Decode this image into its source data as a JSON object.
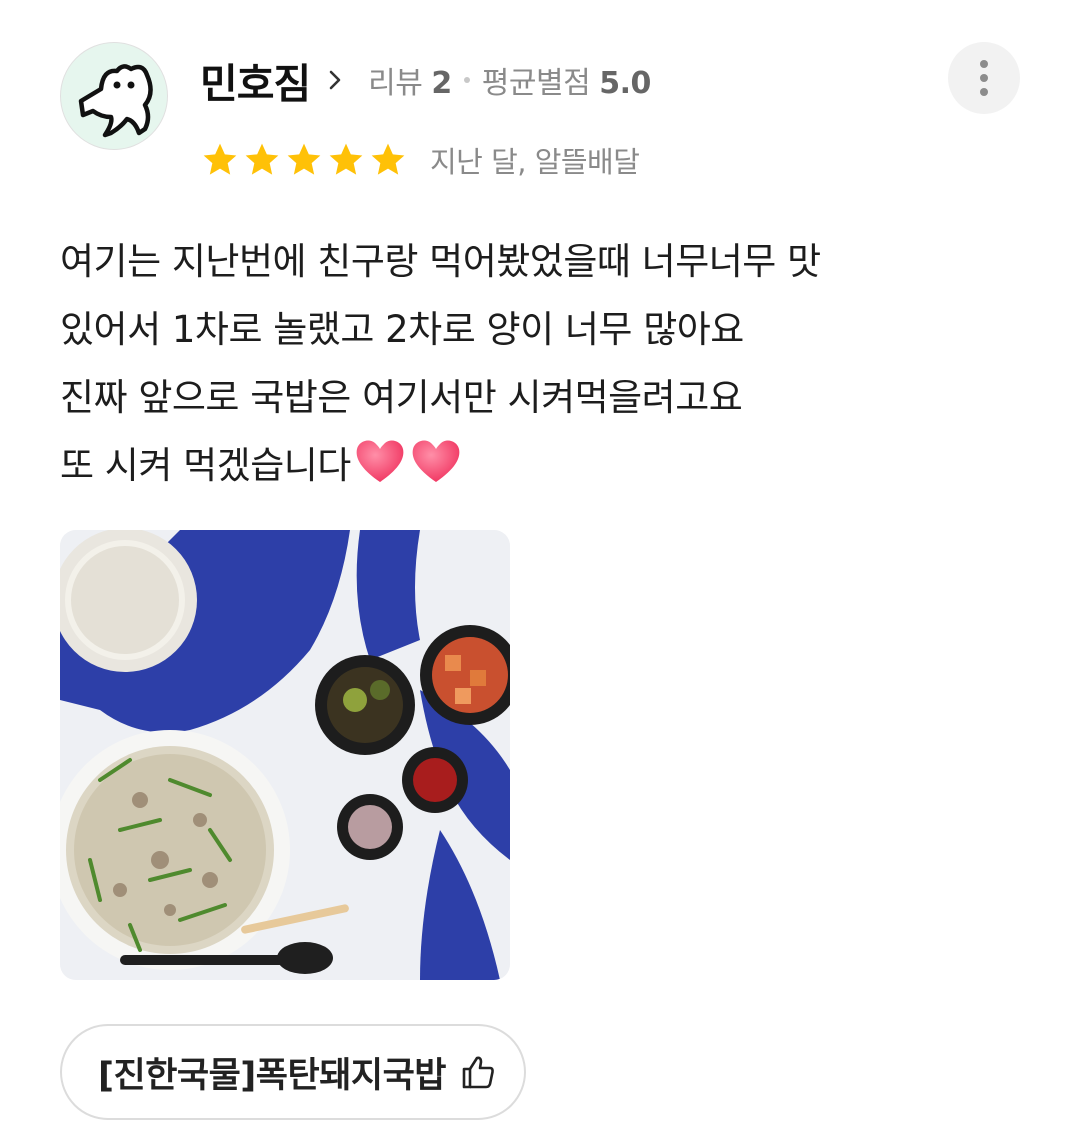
{
  "review": {
    "author": {
      "nickname": "민호짐",
      "review_count_label": "리뷰",
      "review_count": "2",
      "avg_rating_label": "평균별점",
      "avg_rating": "5.0"
    },
    "rating": 5,
    "rating_max": 5,
    "date_label": "지난 달, 알뜰배달",
    "text_lines": [
      "여기는 지난번에 친구랑 먹어봤었을때 너무너무 맛",
      "있어서 1차로 놀랬고 2차로 양이 너무 많아요",
      "진짜 앞으로 국밥은 여기서만 시켜먹을려고요",
      "또 시켜 먹겠습니다"
    ],
    "menu_item": "[진한국물]폭탄돼지국밥"
  },
  "icons": {
    "more": "more-vertical-icon",
    "chevron": "chevron-right-icon",
    "star": "star-icon",
    "heart": "heart-emoji",
    "thumbs_up": "thumbs-up-icon"
  },
  "colors": {
    "star": "#FFC107",
    "heart": "#F43F6B",
    "meta_text": "#8A8A8A"
  }
}
